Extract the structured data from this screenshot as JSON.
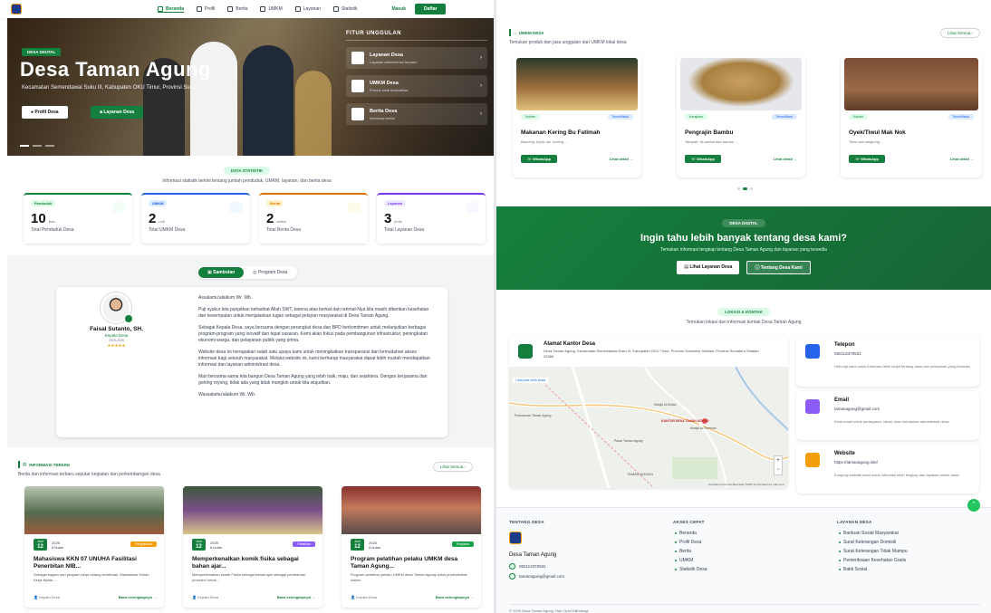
{
  "nav": {
    "links": [
      "Beranda",
      "Profil",
      "Berita",
      "UMKM",
      "Layanan",
      "Statistik"
    ],
    "masuk": "Masuk",
    "daftar": "Daftar"
  },
  "hero": {
    "badge": "DESA DIGITAL",
    "title": "Desa Taman Agung",
    "subtitle": "Kecamatan Semendawai Suku III, Kabupaten OKU Timur, Provinsi Sumatera Selatan",
    "btn_profil": "Profil Desa",
    "btn_layanan": "Layanan Desa",
    "fitur_title": "FITUR UNGGULAN",
    "fitur": [
      {
        "name": "Layanan Desa",
        "desc": "Layanan administrasi terpadu"
      },
      {
        "name": "UMKM Desa",
        "desc": "Produk lokal berkualitas"
      },
      {
        "name": "Berita Desa",
        "desc": "Informasi terkini"
      }
    ]
  },
  "stats": {
    "badge": "DATA STATISTIK",
    "subtitle": "Informasi statistik terkini tentang jumlah penduduk, UMKM, layanan, dan berita desa",
    "cards": [
      {
        "chip": "Penduduk",
        "value": "10",
        "unit": "jiwa",
        "label": "Total Penduduk Desa",
        "color": "#15803d",
        "bg": "#dcfce7"
      },
      {
        "chip": "UMKM",
        "value": "2",
        "unit": "unit",
        "label": "Total UMKM Desa",
        "color": "#2563eb",
        "bg": "#dbeafe"
      },
      {
        "chip": "Berita",
        "value": "2",
        "unit": "artikel",
        "label": "Total Berita Desa",
        "color": "#d97706",
        "bg": "#fef3c7"
      },
      {
        "chip": "Layanan",
        "value": "3",
        "unit": "jenis",
        "label": "Total Layanan Desa",
        "color": "#7c3aed",
        "bg": "#ede9fe"
      }
    ]
  },
  "sambutan": {
    "tab_active": "Sambutan",
    "tab_other": "Program Desa",
    "name": "Faisal Sutanto, SH.",
    "role": "Kepala Desa",
    "period": "2020-2026",
    "stars": "★★★★★",
    "paragraphs": [
      "Assalamu'alaikum Wr. Wb.",
      "Puji syukur kita panjatkan kehadirat Allah SWT, karena atas berkat dan rahmat-Nya kita masih diberikan kesehatan dan kesempatan untuk menjalankan tugas sebagai pelayan masyarakat di Desa Taman Agung.",
      "Sebagai Kepala Desa, saya bersama dengan perangkat desa dan BPD berkomitmen untuk melanjutkan berbagai program-program yang inovatif dan tepat sasaran. Kami akan fokus pada pembangunan infrastruktur, peningkatan ekonomi warga, dan pelayanan publik yang prima.",
      "Website desa ini merupakan salah satu upaya kami untuk meningkatkan transparansi dan kemudahan akses informasi bagi seluruh masyarakat. Melalui website ini, kami berharap masyarakat dapat lebih mudah mendapatkan informasi dan layanan administrasi desa.",
      "Mari bersama-sama kita bangun Desa Taman Agung yang lebih baik, maju, dan sejahtera. Dengan kerjasama dan gotong royong, tidak ada yang tidak mungkin untuk kita wujudkan.",
      "Wassalamu'alaikum Wr. Wb."
    ]
  },
  "info": {
    "title": "INFORMASI TERKINI",
    "subtitle": "Berita dan informasi terbaru seputar kegiatan dan perkembangan desa",
    "lihat": "Lihat Semua",
    "news": [
      {
        "day": "12",
        "month": "Juni",
        "year": "2025",
        "time": "8 bulan",
        "cat": "Pengabdian",
        "catcolor": "#f59e0b",
        "title": "Mahasiswa KKN 07 UNUHA Fasilitasi Penerbitan NIB...",
        "excerpt": "Sebagai bagian dari program kerja bidang kemitraan, Mahasiswa Kuliah Kerja Nyata...",
        "author": "Kepala Desa",
        "more": "Baca selengkapnya"
      },
      {
        "day": "12",
        "month": "Juni",
        "year": "2025",
        "time": "8 bulan",
        "cat": "Pelatihan",
        "catcolor": "#8b5cf6",
        "title": "Memperkenalkan komik fisika sebagai bahan ajar...",
        "excerpt": "Memperkenalkan komik Fisika sebagai bahan ajar sebagai pembaruan prosedur untuk...",
        "author": "Kepala Desa",
        "more": "Baca selengkapnya"
      },
      {
        "day": "12",
        "month": "Juni",
        "year": "2025",
        "time": "8 bulan",
        "cat": "Kegiatan",
        "catcolor": "#16a34a",
        "title": "Program pelatihan pelaku UMKM desa Taman Agung...",
        "excerpt": "Program pelatihan pelaku UMKM desa Taman Agung untuk produktivitas dalam...",
        "author": "Kepala Desa",
        "more": "Baca selengkapnya"
      }
    ]
  },
  "umkm": {
    "title": "UMKM DESA",
    "subtitle": "Temukan produk dan jasa unggulan dari UMKM lokal desa",
    "lihat": "Lihat Semua",
    "products": [
      {
        "kat": "Kuliner",
        "ver": "Terverifikasi",
        "name": "Makanan Kering Bu Fatimah",
        "desc": "Basreng, kripik ubi, lonting ...",
        "wa": "WhatsApp",
        "detail": "Lihat detail"
      },
      {
        "kat": "Kerajinan",
        "ver": "Terverifikasi",
        "name": "Pengrajin Bambu",
        "desc": "Tampah, tik-tomba dari bambu ...",
        "wa": "WhatsApp",
        "detail": "Lihat detail"
      },
      {
        "kat": "Kuliner",
        "ver": "Terverifikasi",
        "name": "Oyek/Tiwul Mak Nok",
        "desc": "Tiwul dari singkong ...",
        "wa": "WhatsApp",
        "detail": "Lihat detail"
      }
    ]
  },
  "cta": {
    "badge": "DESA DIGITAL",
    "title": "Ingin tahu lebih banyak tentang desa kami?",
    "subtitle": "Temukan informasi lengkap tentang Desa Taman Agung dan layanan yang tersedia",
    "btn1": "Lihat Layanan Desa",
    "btn2": "Tentang Desa Kami"
  },
  "lokasi": {
    "badge": "LOKASI & KONTAK",
    "subtitle": "Temukan lokasi dan informasi kontak Desa Taman Agung",
    "addr_title": "Alamat Kantor Desa",
    "addr": "Desa Taman Agung, Kecamatan Semendawai Suku III, Kabupaten OKU Timur, Provinsi Sumatera Selatan, Provinsi Sumatera Selatan 32386",
    "map_places": [
      "Lihat peta lebih besar",
      "Masjid Al-Ikhlas",
      "Masjid Ar-Rahman",
      "KANTOR DESA TAMAN AGUNG",
      "Puskesmas Taman Agung",
      "Pasar Taman Agung",
      "TAMAN AGUNG"
    ],
    "map_attr": "Keyboard shortcuts  Map data ©2025  Terms  Report a map error",
    "contacts": [
      {
        "title": "Telepon",
        "value": "082113370531",
        "desc": "Hubungi kami untuk informasi lebih lanjut tentang desa dan pelayanan yang tersedia",
        "color": "#2563eb"
      },
      {
        "title": "Email",
        "value": "tamanagung@gmail.com",
        "desc": "Kirim email untuk pertanyaan, saran, atau kebutuhan administrasi desa.",
        "color": "#8b5cf6"
      },
      {
        "title": "Website",
        "value": "https://tamanagung.site/",
        "desc": "Kunjungi website kami untuk informasi lebih lengkap dan layanan online desa.",
        "color": "#f59e0b"
      }
    ]
  },
  "footer": {
    "h1": "TENTANG DESA",
    "h2": "AKSES CEPAT",
    "h3": "LAYANAN DESA",
    "name": "Desa Taman Agung",
    "phone": "082113370531",
    "email": "tamanagung@gmail.com",
    "akses": [
      "Beranda",
      "Profil Desa",
      "Berita",
      "UMKM",
      "Statistik Desa"
    ],
    "layanan": [
      "Bantuan Sosial Masyarakat",
      "Surat Keterangan Domisili",
      "Surat Keterangan Tidak Mampu",
      "Pemeriksaan Kesehatan Gratis",
      "Bakti Sosial"
    ],
    "copyright": "© 2025 Desa Taman Agung. Hak Cipta Dilindungi."
  }
}
